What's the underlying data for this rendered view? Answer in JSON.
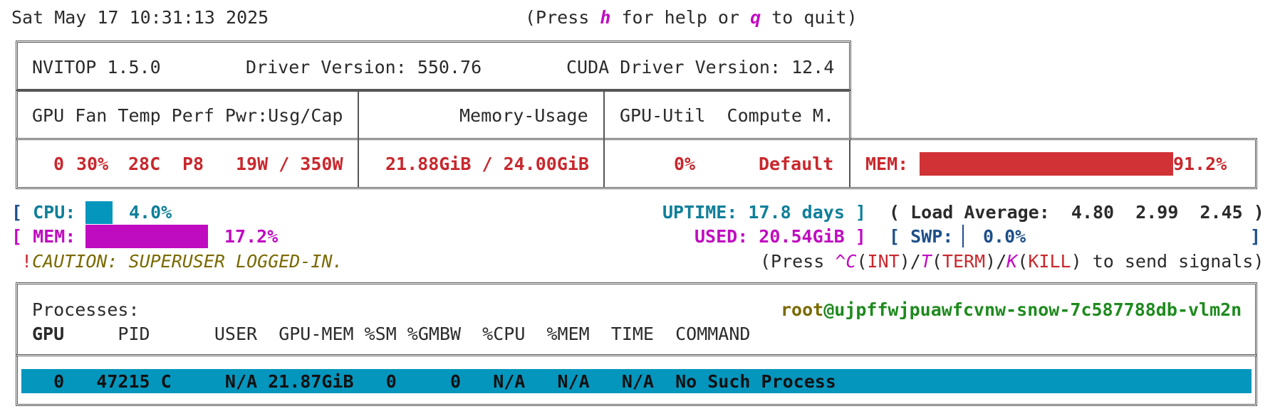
{
  "header": {
    "datetime": "Sat May 17 10:31:13 2025",
    "help_press": "(Press ",
    "help_key": "h",
    "help_mid": " for help or ",
    "quit_key": "q",
    "help_end": " to quit)"
  },
  "info": {
    "app_version": "NVITOP 1.5.0",
    "driver": "Driver Version: 550.76",
    "cuda": "CUDA Driver Version: 12.4"
  },
  "gpu_columns": {
    "col1": "GPU Fan Temp Perf Pwr:Usg/Cap",
    "col2": "Memory-Usage",
    "col3": "GPU-Util  Compute M."
  },
  "gpu_row": {
    "index": "0",
    "fan": "30%",
    "temp": "28C",
    "perf": "P8",
    "power": "19W / 350W",
    "memory": "21.88GiB / 24.00GiB",
    "util": "0%",
    "compute_mode": "Default",
    "mem_label": "MEM:",
    "mem_percent": "91.2%",
    "mem_fraction": 0.912
  },
  "host": {
    "cpu_open": "[ ",
    "cpu_label": "CPU:",
    "cpu_value": "4.0%",
    "cpu_fraction": 0.04,
    "uptime": "UPTIME: 17.8 days ]",
    "load_label": "( Load Average:",
    "load_values": "4.80  2.99  2.45 )",
    "mem_open": "[ ",
    "mem_label": "MEM:",
    "mem_value": "17.2%",
    "mem_fraction": 0.172,
    "used": "USED: 20.54GiB ]",
    "swp_open": "[ ",
    "swp_label": "SWP:",
    "swp_value": "0.0%",
    "swp_close": "]",
    "caution_bang": "!",
    "caution_text": "CAUTION: SUPERUSER LOGGED-IN.",
    "signals": {
      "p1": "(Press ",
      "ctrl_c": "^C",
      "p2": "(",
      "int": "INT",
      "p3": ")/",
      "t_key": "T",
      "p4": "(",
      "term": "TERM",
      "p5": ")/",
      "k_key": "K",
      "p6": "(",
      "kill": "KILL",
      "p7": ") to send signals)"
    }
  },
  "processes": {
    "title": "Processes:",
    "user": "root",
    "at_host": "@ujpffwjpuawfcvnw-snow-7c587788db-vlm2n",
    "headers": {
      "gpu": "GPU",
      "rest": "PID      USER  GPU-MEM %SM %GMBW  %CPU  %MEM  TIME  COMMAND"
    },
    "rows": [
      {
        "line": "  0   47215 C     N/A 21.87GiB   0     0   N/A   N/A   N/A  No Such Process"
      }
    ]
  },
  "colors": {
    "gpu_mem_bar": "#d03236",
    "cpu_bar": "#0596be",
    "mem_bar": "#c00cc0",
    "process_row_bg": "#0596be"
  }
}
